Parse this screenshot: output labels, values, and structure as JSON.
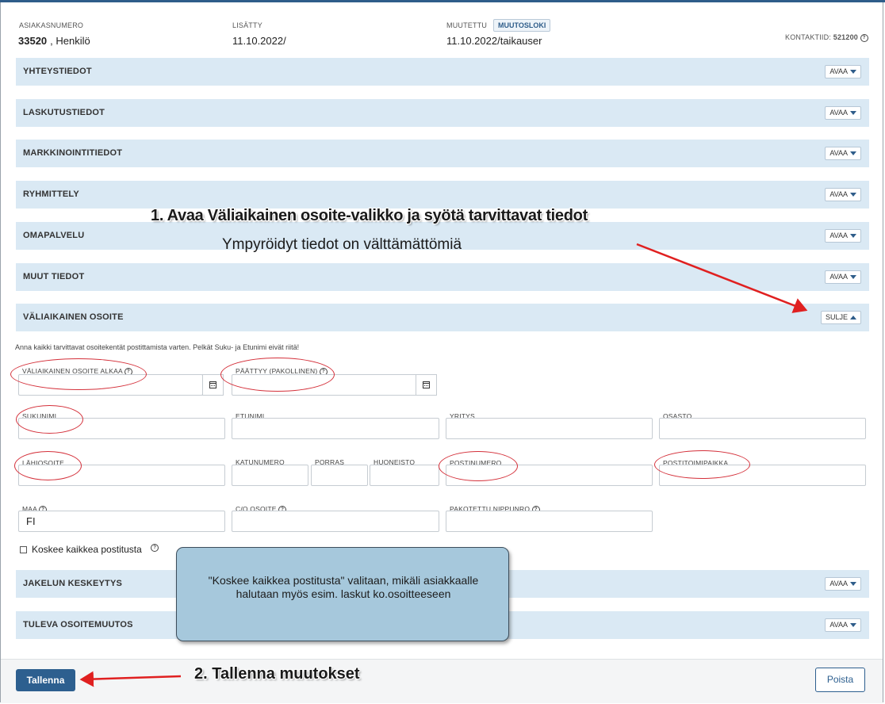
{
  "header": {
    "customer_number_label": "ASIAKASNUMERO",
    "customer_number": "33520",
    "customer_type": ", Henkilö",
    "added_label": "LISÄTTY",
    "added_value": "11.10.2022/",
    "modified_label": "MUUTETTU",
    "changelog_badge": "MUUTOSLOKI",
    "modified_value": "11.10.2022/taikauser",
    "contact_id_label": "KONTAKTIID:",
    "contact_id": "521200"
  },
  "sections": [
    {
      "title": "YHTEYSTIEDOT",
      "button": "AVAA"
    },
    {
      "title": "LASKUTUSTIEDOT",
      "button": "AVAA"
    },
    {
      "title": "MARKKINOINTITIEDOT",
      "button": "AVAA"
    },
    {
      "title": "RYHMITTELY",
      "button": "AVAA"
    },
    {
      "title": "OMAPALVELU",
      "button": "AVAA"
    },
    {
      "title": "MUUT TIEDOT",
      "button": "AVAA"
    },
    {
      "title": "VÄLIAIKAINEN OSOITE",
      "button": "SULJE"
    },
    {
      "title": "JAKELUN KESKEYTYS",
      "button": "AVAA"
    },
    {
      "title": "TULEVA OSOITEMUUTOS",
      "button": "AVAA"
    }
  ],
  "form": {
    "hint": "Anna kaikki tarvittavat osoitekentät postittamista varten. Pelkät Suku- ja Etunimi eivät riitä!",
    "start_label": "VÄLIAIKAINEN OSOITE ALKAA",
    "end_label": "PÄÄTTYY (PAKOLLINEN)",
    "surname_label": "SUKUNIMI",
    "firstname_label": "ETUNIMI",
    "company_label": "YRITYS",
    "department_label": "OSASTO",
    "street_label": "LÄHIOSOITE",
    "street_number_label": "KATUNUMERO",
    "staircase_label": "PORRAS",
    "apartment_label": "HUONEISTO",
    "postal_code_label": "POSTINUMERO",
    "city_label": "POSTITOIMIPAIKKA",
    "country_label": "MAA",
    "country_value": "FI",
    "co_label": "C/O OSOITE",
    "forced_bundle_label": "PAKOTETTU NIPPUNRO",
    "all_mail_label": "Koskee kaikkea postitusta"
  },
  "footer": {
    "save": "Tallenna",
    "delete": "Poista"
  },
  "annotations": {
    "step1": "1. Avaa Väliaikainen osoite-valikko ja syötä tarvittavat tiedot",
    "required_note": "Ympyröidyt tiedot on välttämättömiä",
    "step2": "2. Tallenna muutokset",
    "callout": "\"Koskee kaikkea postitusta\" valitaan, mikäli asiakkaalle halutaan myös esim. laskut ko.osoitteeseen"
  },
  "colors": {
    "section_bg": "#dae9f4",
    "primary": "#2d5f8f",
    "annotation_red": "#d4303a",
    "callout_bg": "#a6c8dc"
  }
}
